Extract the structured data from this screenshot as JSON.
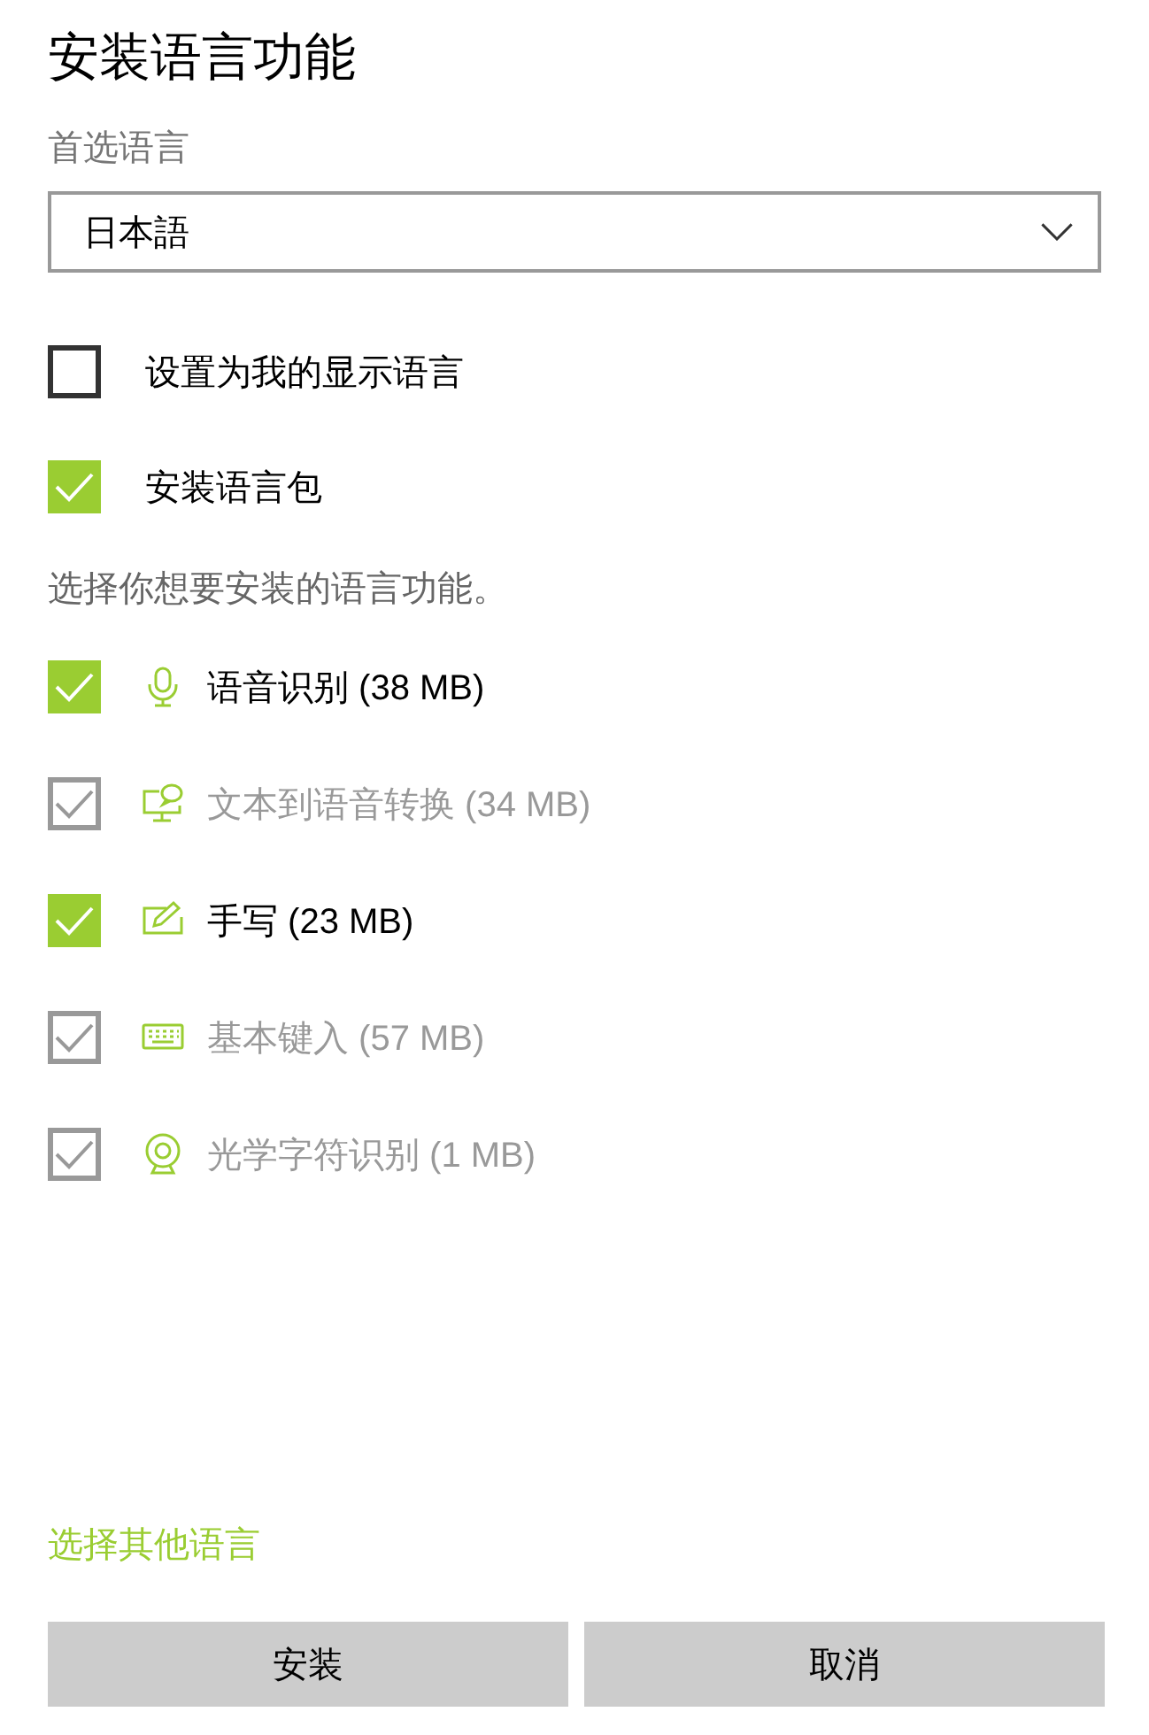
{
  "title": "安装语言功能",
  "preferred_language": {
    "label": "首选语言",
    "value": "日本語"
  },
  "options": [
    {
      "label": "设置为我的显示语言",
      "checked": false
    },
    {
      "label": "安装语言包",
      "checked": true
    }
  ],
  "features_hint": "选择你想要安装的语言功能。",
  "features": [
    {
      "kind": "speech",
      "label": "语音识别 (38 MB)",
      "checked": true,
      "disabled": false
    },
    {
      "kind": "text_to_speech",
      "label": "文本到语音转换 (34 MB)",
      "checked": true,
      "disabled": true
    },
    {
      "kind": "handwriting",
      "label": "手写 (23 MB)",
      "checked": true,
      "disabled": false
    },
    {
      "kind": "typing",
      "label": "基本键入 (57 MB)",
      "checked": true,
      "disabled": true
    },
    {
      "kind": "ocr",
      "label": "光学字符识别 (1 MB)",
      "checked": true,
      "disabled": true
    }
  ],
  "other_language_link": "选择其他语言",
  "buttons": [
    "安装",
    "取消"
  ]
}
